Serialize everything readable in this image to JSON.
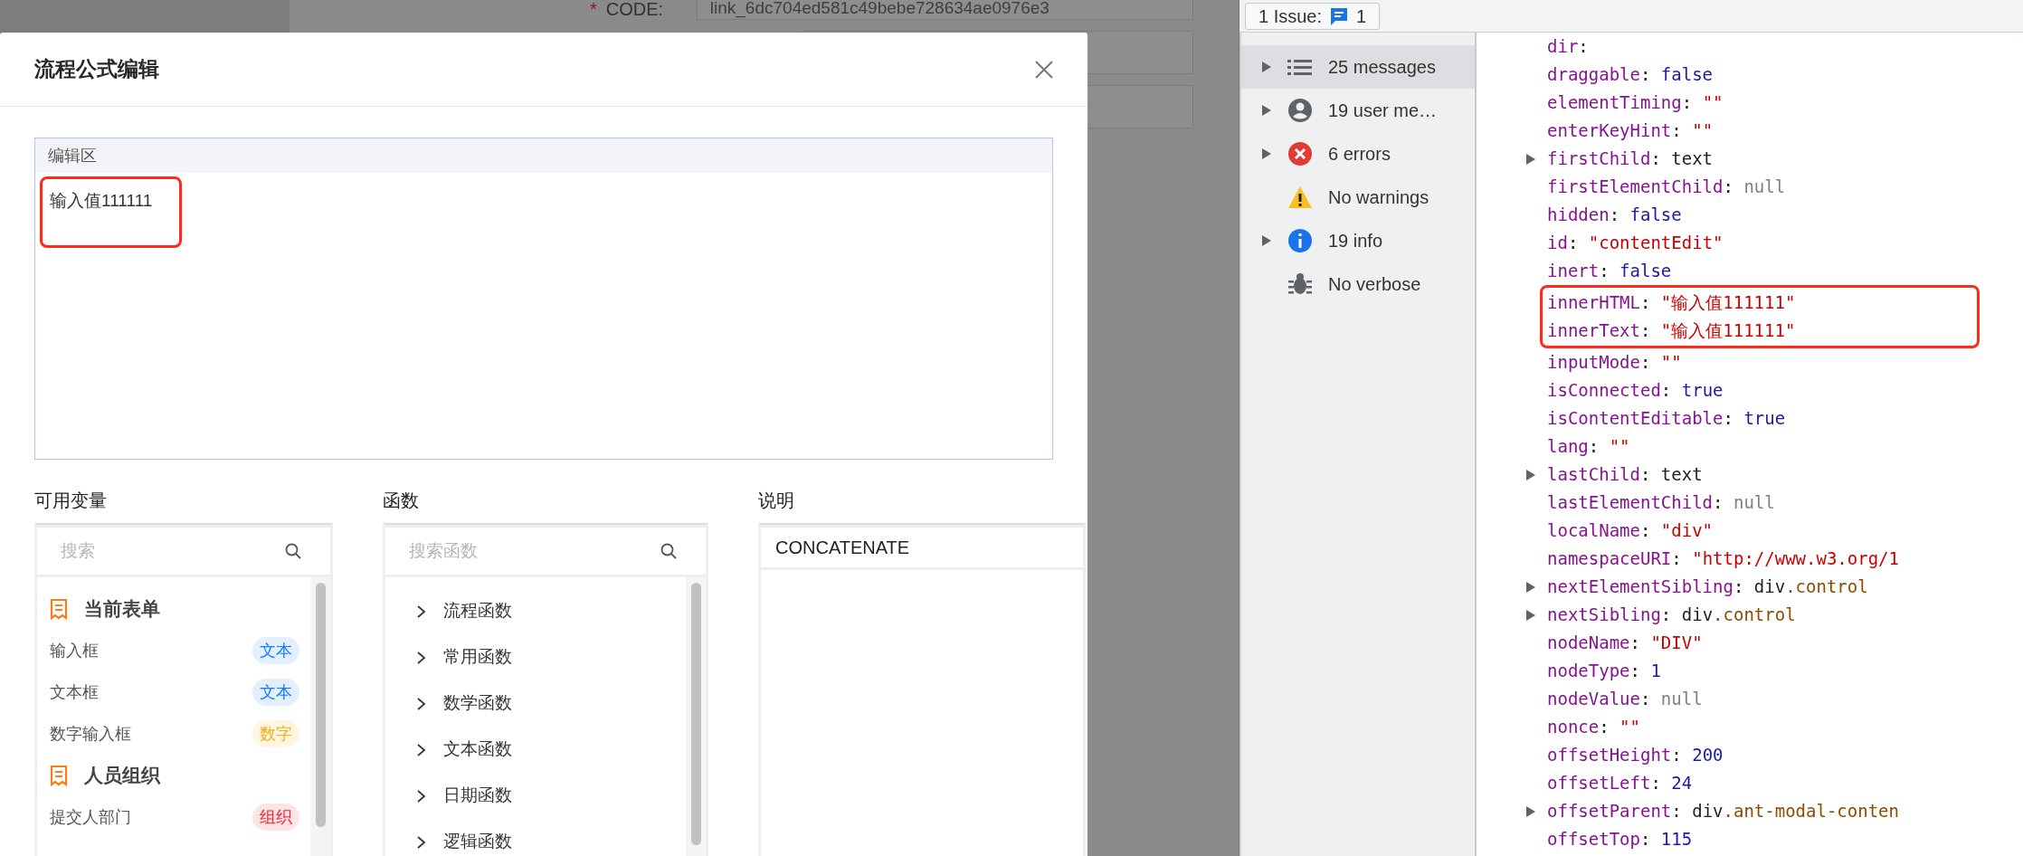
{
  "background_form": {
    "required_mark": "*",
    "code_label": "CODE:",
    "code_value": "link_6dc704ed581c49bebe728634ae0976e3"
  },
  "modal": {
    "title": "流程公式编辑",
    "editor": {
      "label": "编辑区",
      "value": "输入值111111"
    },
    "variables": {
      "title": "可用变量",
      "placeholder": "搜索",
      "groups": [
        {
          "name": "当前表单",
          "items": [
            {
              "label": "输入框",
              "tag": "文本",
              "color": "#1677ff"
            },
            {
              "label": "文本框",
              "tag": "文本",
              "color": "#1677ff"
            },
            {
              "label": "数字输入框",
              "tag": "数字",
              "color": "#faad14"
            }
          ]
        },
        {
          "name": "人员组织",
          "items": [
            {
              "label": "提交人部门",
              "tag": "组织",
              "color": "#f5222d"
            }
          ]
        }
      ]
    },
    "functions": {
      "title": "函数",
      "placeholder": "搜索函数",
      "items": [
        {
          "label": "流程函数",
          "expanded": false
        },
        {
          "label": "常用函数",
          "expanded": false
        },
        {
          "label": "数学函数",
          "expanded": false
        },
        {
          "label": "文本函数",
          "expanded": false
        },
        {
          "label": "日期函数",
          "expanded": false
        },
        {
          "label": "逻辑函数",
          "expanded": false
        }
      ]
    },
    "description": {
      "title": "说明",
      "heading": "CONCATENATE"
    }
  },
  "devtools": {
    "separator": ":",
    "issues": {
      "label": "1 Issue:",
      "count": "1"
    },
    "sidebar": [
      {
        "kind": "messages",
        "label": "25 messages",
        "expandable": true,
        "selected": true
      },
      {
        "kind": "user",
        "label": "19 user me…",
        "expandable": true,
        "selected": false
      },
      {
        "kind": "errors",
        "label": "6 errors",
        "expandable": true,
        "selected": false
      },
      {
        "kind": "warnings",
        "label": "No warnings",
        "expandable": false,
        "selected": false
      },
      {
        "kind": "info",
        "label": "19 info",
        "expandable": true,
        "selected": false
      },
      {
        "kind": "verbose",
        "label": "No verbose",
        "expandable": false,
        "selected": false
      }
    ],
    "properties": [
      {
        "key": "dir",
        "kind": "none"
      },
      {
        "key": "draggable",
        "value": "false",
        "kind": "bool"
      },
      {
        "key": "elementTiming",
        "value": "\"\"",
        "kind": "string"
      },
      {
        "key": "enterKeyHint",
        "value": "\"\"",
        "kind": "string"
      },
      {
        "key": "firstChild",
        "value": "text",
        "kind": "object",
        "expandable": true
      },
      {
        "key": "firstElementChild",
        "value": "null",
        "kind": "null"
      },
      {
        "key": "hidden",
        "value": "false",
        "kind": "bool"
      },
      {
        "key": "id",
        "value": "\"contentEdit\"",
        "kind": "string"
      },
      {
        "key": "inert",
        "value": "false",
        "kind": "bool"
      },
      {
        "key": "innerHTML",
        "value": "\"输入值111111\"",
        "kind": "string",
        "highlighted": true
      },
      {
        "key": "innerText",
        "value": "\"输入值111111\"",
        "kind": "string",
        "highlighted": true
      },
      {
        "key": "inputMode",
        "value": "\"\"",
        "kind": "string"
      },
      {
        "key": "isConnected",
        "value": "true",
        "kind": "bool"
      },
      {
        "key": "isContentEditable",
        "value": "true",
        "kind": "bool"
      },
      {
        "key": "lang",
        "value": "\"\"",
        "kind": "string"
      },
      {
        "key": "lastChild",
        "value": "text",
        "kind": "object",
        "expandable": true
      },
      {
        "key": "lastElementChild",
        "value": "null",
        "kind": "null"
      },
      {
        "key": "localName",
        "value": "\"div\"",
        "kind": "string"
      },
      {
        "key": "namespaceURI",
        "value": "\"http://www.w3.org/1",
        "kind": "string"
      },
      {
        "key": "nextElementSibling",
        "value": "div",
        "suffix": ".control",
        "kind": "object",
        "expandable": true
      },
      {
        "key": "nextSibling",
        "value": "div",
        "suffix": ".control",
        "kind": "object",
        "expandable": true
      },
      {
        "key": "nodeName",
        "value": "\"DIV\"",
        "kind": "string"
      },
      {
        "key": "nodeType",
        "value": "1",
        "kind": "number"
      },
      {
        "key": "nodeValue",
        "value": "null",
        "kind": "null"
      },
      {
        "key": "nonce",
        "value": "\"\"",
        "kind": "string"
      },
      {
        "key": "offsetHeight",
        "value": "200",
        "kind": "number"
      },
      {
        "key": "offsetLeft",
        "value": "24",
        "kind": "number"
      },
      {
        "key": "offsetParent",
        "value": "div",
        "suffix": ".ant-modal-conten",
        "kind": "object",
        "expandable": true
      },
      {
        "key": "offsetTop",
        "value": "115",
        "kind": "number"
      }
    ]
  }
}
